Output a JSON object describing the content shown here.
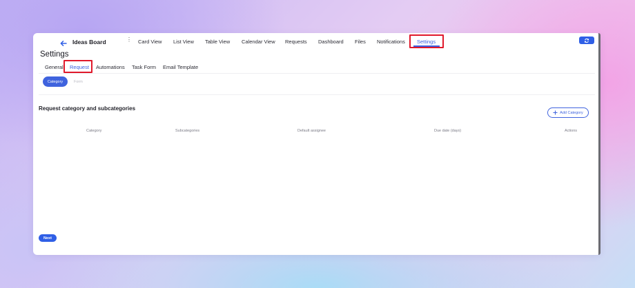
{
  "header": {
    "board_title": "Ideas Board",
    "nav_tabs": [
      {
        "label": "Card View"
      },
      {
        "label": "List View"
      },
      {
        "label": "Table View"
      },
      {
        "label": "Calendar View"
      },
      {
        "label": "Requests"
      },
      {
        "label": "Dashboard"
      },
      {
        "label": "Files"
      },
      {
        "label": "Notifications"
      },
      {
        "label": "Settings",
        "active": true
      }
    ]
  },
  "page": {
    "title": "Settings",
    "sub_tabs": [
      {
        "label": "General"
      },
      {
        "label": "Request",
        "active": true
      },
      {
        "label": "Automations"
      },
      {
        "label": "Task Form"
      },
      {
        "label": "Email Template"
      }
    ],
    "pills": {
      "category": "Category",
      "form": "Form"
    }
  },
  "section": {
    "title": "Request category and subcategories",
    "add_button": "Add Category",
    "columns": [
      "Category",
      "Subcategories",
      "Default assignee",
      "Due date (days)",
      "Actions"
    ]
  },
  "footer": {
    "next_label": "Next"
  },
  "colors": {
    "accent": "#3f63de",
    "highlight": "#e0182a",
    "active_text": "#3a5fe0"
  },
  "icons": {
    "back": "arrow-left-icon",
    "refresh": "refresh-icon",
    "more": "kebab-icon",
    "add": "plus-icon"
  }
}
